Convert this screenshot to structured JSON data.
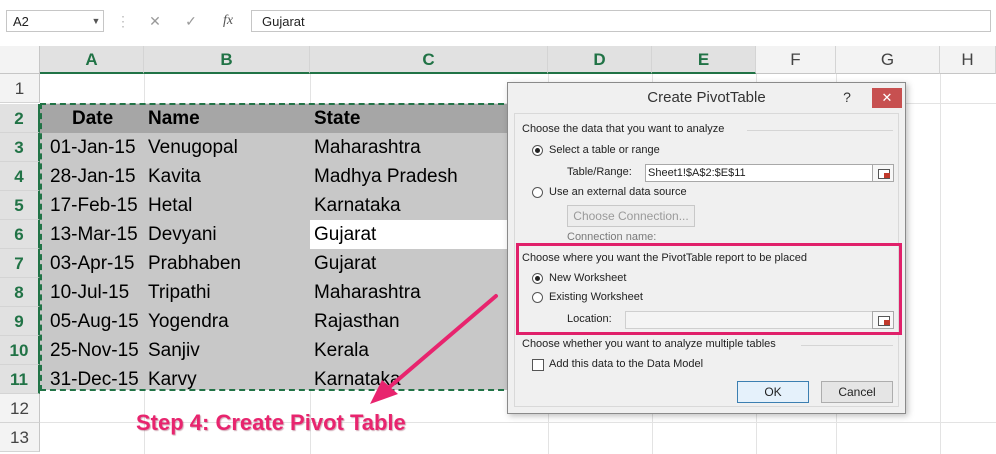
{
  "formula_bar": {
    "name_box": "A2",
    "cancel_glyph": "✕",
    "enter_glyph": "✓",
    "fx_glyph": "fx",
    "formula": "Gujarat"
  },
  "columns": [
    "A",
    "B",
    "C",
    "D",
    "E",
    "F",
    "G",
    "H"
  ],
  "rows": [
    "1",
    "2",
    "3",
    "4",
    "5",
    "6",
    "7",
    "8",
    "9",
    "10",
    "11",
    "12",
    "13"
  ],
  "table": {
    "headers": [
      "Date",
      "Name",
      "State"
    ],
    "rows": [
      [
        "01-Jan-15",
        "Venugopal",
        "Maharashtra"
      ],
      [
        "28-Jan-15",
        "Kavita",
        "Madhya Pradesh"
      ],
      [
        "17-Feb-15",
        "Hetal",
        "Karnataka"
      ],
      [
        "13-Mar-15",
        "Devyani",
        "Gujarat"
      ],
      [
        "03-Apr-15",
        "Prabhaben",
        "Gujarat"
      ],
      [
        "10-Jul-15",
        "Tripathi",
        "Maharashtra"
      ],
      [
        "05-Aug-15",
        "Yogendra",
        "Rajasthan"
      ],
      [
        "25-Nov-15",
        "Sanjiv",
        "Kerala"
      ],
      [
        "31-Dec-15",
        "Karvy",
        "Karnataka"
      ]
    ]
  },
  "dialog": {
    "title": "Create PivotTable",
    "help": "?",
    "minimize": "–",
    "close": "✕",
    "section1": "Choose the data that you want to analyze",
    "opt_select_range": "Select a table or range",
    "table_range_label": "Table/Range:",
    "table_range_value": "Sheet1!$A$2:$E$11",
    "opt_external": "Use an external data source",
    "choose_connection": "Choose Connection...",
    "connection_name": "Connection name:",
    "section2": "Choose where you want the PivotTable report to be placed",
    "opt_new_ws": "New Worksheet",
    "opt_existing_ws": "Existing Worksheet",
    "location_label": "Location:",
    "location_value": "",
    "section3": "Choose whether you want to analyze multiple tables",
    "add_data_model": "Add this data to the Data Model",
    "ok": "OK",
    "cancel": "Cancel"
  },
  "annotation": "Step 4: Create Pivot Table",
  "colors": {
    "excel_green": "#217346",
    "highlight": "#e0206a",
    "selection_fill": "#c8c8c8",
    "header_fill": "#a6a6a6"
  }
}
